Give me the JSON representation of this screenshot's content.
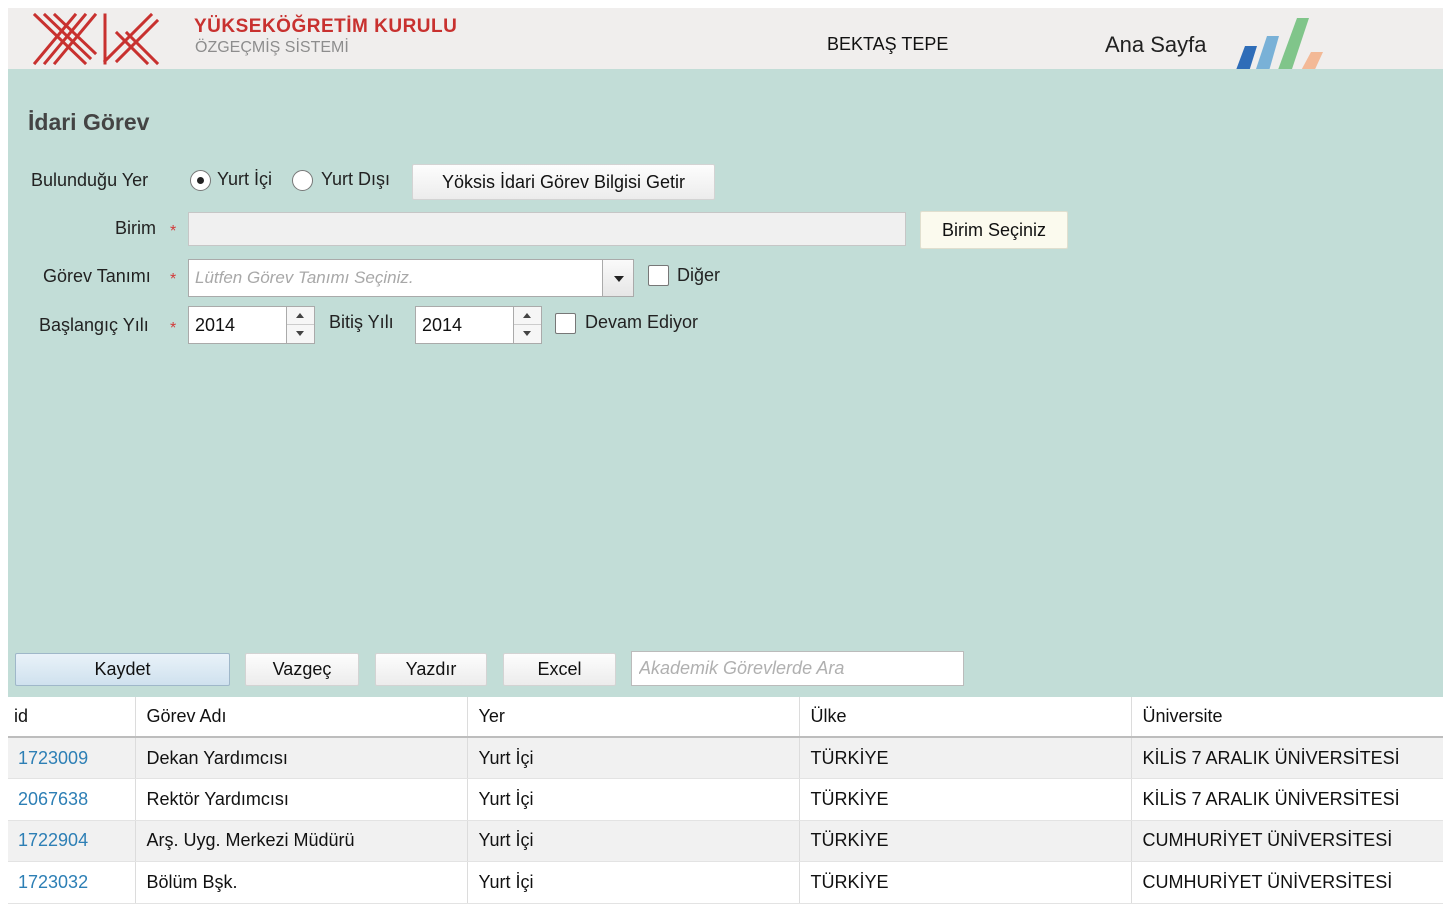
{
  "header": {
    "brand_title": "YÜKSEKÖĞRETİM KURULU",
    "brand_subtitle": "ÖZGEÇMİŞ SİSTEMİ",
    "user_name": "BEKTAŞ TEPE",
    "home_link": "Ana Sayfa",
    "logo_icon": "yok-logo-icon",
    "brand_colors": {
      "red": "#c8312f",
      "blue": "#2f6db8",
      "light_blue": "#79b1d7",
      "green": "#80c58a",
      "peach": "#f3b996"
    }
  },
  "form": {
    "title": "İdari Görev",
    "location_label": "Bulunduğu Yer",
    "radio_domestic": "Yurt İçi",
    "radio_abroad": "Yurt Dışı",
    "selected_location": "Yurt İçi",
    "fetch_button": "Yöksis İdari Görev Bilgisi Getir",
    "unit_label": "Birim",
    "unit_value": "",
    "unit_button": "Birim Seçiniz",
    "task_label": "Görev Tanımı",
    "task_placeholder": "Lütfen Görev Tanımı Seçiniz.",
    "other_label": "Diğer",
    "start_label": "Başlangıç Yılı",
    "start_value": "2014",
    "end_label": "Bitiş Yılı",
    "end_value": "2014",
    "ongoing_label": "Devam Ediyor",
    "required_mark": "*"
  },
  "actions": {
    "save": "Kaydet",
    "cancel": "Vazgeç",
    "print": "Yazdır",
    "excel": "Excel",
    "search_placeholder": "Akademik Görevlerde Ara"
  },
  "table": {
    "columns": [
      "id",
      "Görev Adı",
      "Yer",
      "Ülke",
      "Üniversite"
    ],
    "rows": [
      [
        "1723009",
        "Dekan Yardımcısı",
        "Yurt İçi",
        "TÜRKİYE",
        "KİLİS 7 ARALIK ÜNİVERSİTESİ"
      ],
      [
        "2067638",
        "Rektör Yardımcısı",
        "Yurt İçi",
        "TÜRKİYE",
        "KİLİS 7 ARALIK ÜNİVERSİTESİ"
      ],
      [
        "1722904",
        "Arş. Uyg. Merkezi Müdürü",
        "Yurt İçi",
        "TÜRKİYE",
        "CUMHURİYET ÜNİVERSİTESİ"
      ],
      [
        "1723032",
        "Bölüm Bşk.",
        "Yurt İçi",
        "TÜRKİYE",
        "CUMHURİYET ÜNİVERSİTESİ"
      ]
    ]
  },
  "colors": {
    "panel_bg": "#c2ddd7",
    "header_bg": "#f0eeed",
    "link": "#2d7fb5"
  }
}
